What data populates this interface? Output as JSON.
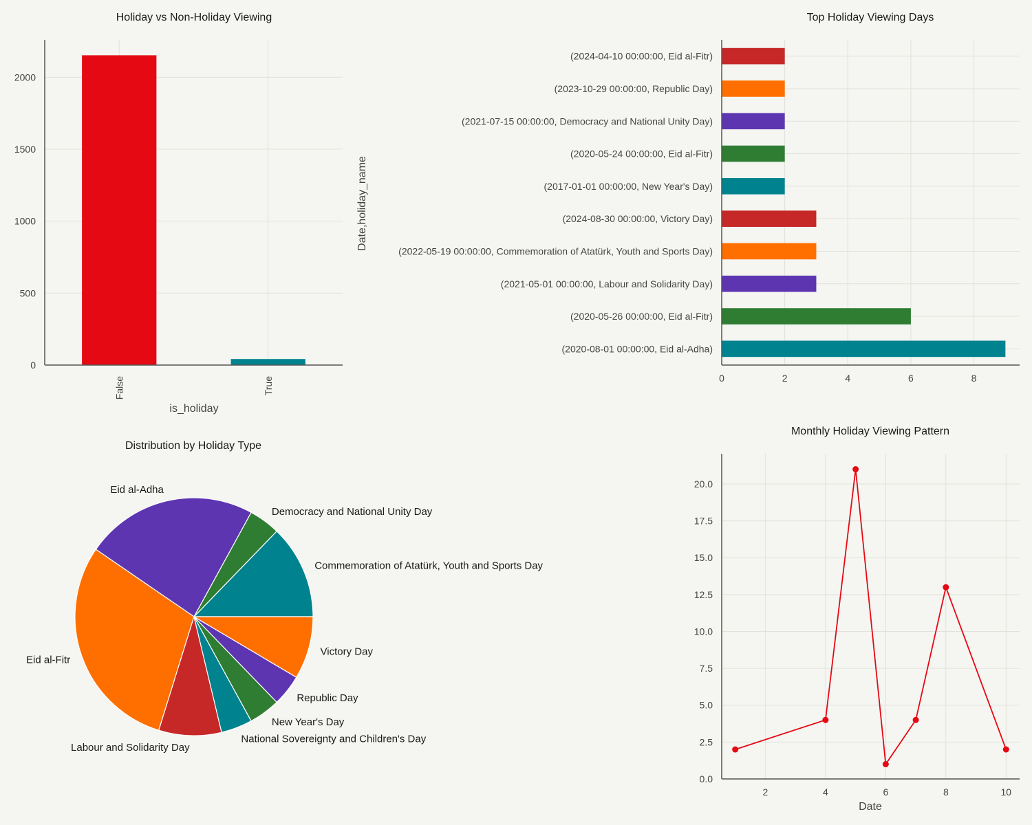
{
  "chart_data": [
    {
      "type": "bar",
      "title": "Holiday vs Non-Holiday Viewing",
      "xlabel": "is_holiday",
      "ylabel": "",
      "categories": [
        "False",
        "True"
      ],
      "values": [
        2153,
        42
      ],
      "colors": [
        "#e50914",
        "#00838f"
      ],
      "ylim": [
        0,
        2260
      ],
      "yticks": [
        0,
        500,
        1000,
        1500,
        2000
      ],
      "grid": true
    },
    {
      "type": "bar",
      "orientation": "horizontal",
      "title": "Top Holiday Viewing Days",
      "xlabel": "",
      "ylabel": "Date,holiday_name",
      "categories": [
        "(2024-04-10 00:00:00, Eid al-Fitr)",
        "(2023-10-29 00:00:00, Republic Day)",
        "(2021-07-15 00:00:00, Democracy and National Unity Day)",
        "(2020-05-24 00:00:00, Eid al-Fitr)",
        "(2017-01-01 00:00:00, New Year's Day)",
        "(2024-08-30 00:00:00, Victory Day)",
        "(2022-05-19 00:00:00, Commemoration of Atatürk, Youth and Sports Day)",
        "(2021-05-01 00:00:00, Labour and Solidarity Day)",
        "(2020-05-26 00:00:00, Eid al-Fitr)",
        "(2020-08-01 00:00:00, Eid al-Adha)"
      ],
      "values": [
        2,
        2,
        2,
        2,
        2,
        3,
        3,
        3,
        6,
        9
      ],
      "colors": [
        "#c62828",
        "#ff6f00",
        "#5e35b1",
        "#2e7d32",
        "#00838f",
        "#c62828",
        "#ff6f00",
        "#5e35b1",
        "#2e7d32",
        "#00838f"
      ],
      "xlim": [
        0,
        9.45
      ],
      "xticks": [
        0,
        2,
        4,
        6,
        8
      ],
      "grid": true
    },
    {
      "type": "pie",
      "title": "Distribution by Holiday Type",
      "slices": [
        {
          "label": "Commemoration of Atatürk, Youth and Sports Day",
          "value": 6,
          "color": "#00838f"
        },
        {
          "label": "Democracy and National Unity Day",
          "value": 2,
          "color": "#2e7d32"
        },
        {
          "label": "Eid al-Adha",
          "value": 11,
          "color": "#5e35b1"
        },
        {
          "label": "Eid al-Fitr",
          "value": 14,
          "color": "#ff6f00"
        },
        {
          "label": "Labour and Solidarity Day",
          "value": 4,
          "color": "#c62828"
        },
        {
          "label": "National Sovereignty and Children's Day",
          "value": 2,
          "color": "#00838f"
        },
        {
          "label": "New Year's Day",
          "value": 2,
          "color": "#2e7d32"
        },
        {
          "label": "Republic Day",
          "value": 2,
          "color": "#5e35b1"
        },
        {
          "label": "Victory Day",
          "value": 4,
          "color": "#ff6f00"
        }
      ]
    },
    {
      "type": "line",
      "title": "Monthly Holiday Viewing Pattern",
      "xlabel": "Date",
      "ylabel": "",
      "x": [
        1,
        4,
        5,
        6,
        7,
        8,
        10
      ],
      "y": [
        2,
        4,
        21,
        1,
        4,
        13,
        2
      ],
      "color": "#e50914",
      "xlim": [
        0.55,
        10.45
      ],
      "ylim": [
        0,
        22.05
      ],
      "xticks": [
        2,
        4,
        6,
        8,
        10
      ],
      "yticks": [
        "0.0",
        "2.5",
        "5.0",
        "7.5",
        "10.0",
        "12.5",
        "15.0",
        "17.5",
        "20.0"
      ],
      "grid": true
    }
  ]
}
